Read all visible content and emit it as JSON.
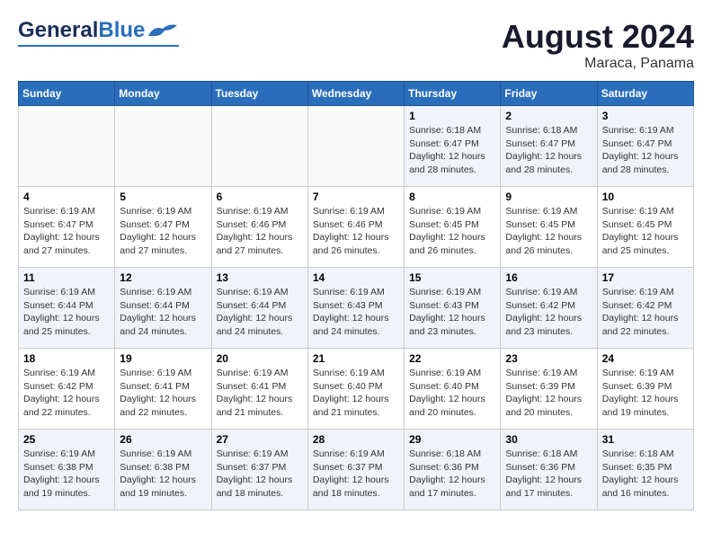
{
  "header": {
    "logo_general": "General",
    "logo_blue": "Blue",
    "title": "August 2024",
    "subtitle": "Maraca, Panama"
  },
  "days_of_week": [
    "Sunday",
    "Monday",
    "Tuesday",
    "Wednesday",
    "Thursday",
    "Friday",
    "Saturday"
  ],
  "weeks": [
    [
      {
        "day": "",
        "info": ""
      },
      {
        "day": "",
        "info": ""
      },
      {
        "day": "",
        "info": ""
      },
      {
        "day": "",
        "info": ""
      },
      {
        "day": "1",
        "info": "Sunrise: 6:18 AM\nSunset: 6:47 PM\nDaylight: 12 hours\nand 28 minutes."
      },
      {
        "day": "2",
        "info": "Sunrise: 6:18 AM\nSunset: 6:47 PM\nDaylight: 12 hours\nand 28 minutes."
      },
      {
        "day": "3",
        "info": "Sunrise: 6:19 AM\nSunset: 6:47 PM\nDaylight: 12 hours\nand 28 minutes."
      }
    ],
    [
      {
        "day": "4",
        "info": "Sunrise: 6:19 AM\nSunset: 6:47 PM\nDaylight: 12 hours\nand 27 minutes."
      },
      {
        "day": "5",
        "info": "Sunrise: 6:19 AM\nSunset: 6:47 PM\nDaylight: 12 hours\nand 27 minutes."
      },
      {
        "day": "6",
        "info": "Sunrise: 6:19 AM\nSunset: 6:46 PM\nDaylight: 12 hours\nand 27 minutes."
      },
      {
        "day": "7",
        "info": "Sunrise: 6:19 AM\nSunset: 6:46 PM\nDaylight: 12 hours\nand 26 minutes."
      },
      {
        "day": "8",
        "info": "Sunrise: 6:19 AM\nSunset: 6:45 PM\nDaylight: 12 hours\nand 26 minutes."
      },
      {
        "day": "9",
        "info": "Sunrise: 6:19 AM\nSunset: 6:45 PM\nDaylight: 12 hours\nand 26 minutes."
      },
      {
        "day": "10",
        "info": "Sunrise: 6:19 AM\nSunset: 6:45 PM\nDaylight: 12 hours\nand 25 minutes."
      }
    ],
    [
      {
        "day": "11",
        "info": "Sunrise: 6:19 AM\nSunset: 6:44 PM\nDaylight: 12 hours\nand 25 minutes."
      },
      {
        "day": "12",
        "info": "Sunrise: 6:19 AM\nSunset: 6:44 PM\nDaylight: 12 hours\nand 24 minutes."
      },
      {
        "day": "13",
        "info": "Sunrise: 6:19 AM\nSunset: 6:44 PM\nDaylight: 12 hours\nand 24 minutes."
      },
      {
        "day": "14",
        "info": "Sunrise: 6:19 AM\nSunset: 6:43 PM\nDaylight: 12 hours\nand 24 minutes."
      },
      {
        "day": "15",
        "info": "Sunrise: 6:19 AM\nSunset: 6:43 PM\nDaylight: 12 hours\nand 23 minutes."
      },
      {
        "day": "16",
        "info": "Sunrise: 6:19 AM\nSunset: 6:42 PM\nDaylight: 12 hours\nand 23 minutes."
      },
      {
        "day": "17",
        "info": "Sunrise: 6:19 AM\nSunset: 6:42 PM\nDaylight: 12 hours\nand 22 minutes."
      }
    ],
    [
      {
        "day": "18",
        "info": "Sunrise: 6:19 AM\nSunset: 6:42 PM\nDaylight: 12 hours\nand 22 minutes."
      },
      {
        "day": "19",
        "info": "Sunrise: 6:19 AM\nSunset: 6:41 PM\nDaylight: 12 hours\nand 22 minutes."
      },
      {
        "day": "20",
        "info": "Sunrise: 6:19 AM\nSunset: 6:41 PM\nDaylight: 12 hours\nand 21 minutes."
      },
      {
        "day": "21",
        "info": "Sunrise: 6:19 AM\nSunset: 6:40 PM\nDaylight: 12 hours\nand 21 minutes."
      },
      {
        "day": "22",
        "info": "Sunrise: 6:19 AM\nSunset: 6:40 PM\nDaylight: 12 hours\nand 20 minutes."
      },
      {
        "day": "23",
        "info": "Sunrise: 6:19 AM\nSunset: 6:39 PM\nDaylight: 12 hours\nand 20 minutes."
      },
      {
        "day": "24",
        "info": "Sunrise: 6:19 AM\nSunset: 6:39 PM\nDaylight: 12 hours\nand 19 minutes."
      }
    ],
    [
      {
        "day": "25",
        "info": "Sunrise: 6:19 AM\nSunset: 6:38 PM\nDaylight: 12 hours\nand 19 minutes."
      },
      {
        "day": "26",
        "info": "Sunrise: 6:19 AM\nSunset: 6:38 PM\nDaylight: 12 hours\nand 19 minutes."
      },
      {
        "day": "27",
        "info": "Sunrise: 6:19 AM\nSunset: 6:37 PM\nDaylight: 12 hours\nand 18 minutes."
      },
      {
        "day": "28",
        "info": "Sunrise: 6:19 AM\nSunset: 6:37 PM\nDaylight: 12 hours\nand 18 minutes."
      },
      {
        "day": "29",
        "info": "Sunrise: 6:18 AM\nSunset: 6:36 PM\nDaylight: 12 hours\nand 17 minutes."
      },
      {
        "day": "30",
        "info": "Sunrise: 6:18 AM\nSunset: 6:36 PM\nDaylight: 12 hours\nand 17 minutes."
      },
      {
        "day": "31",
        "info": "Sunrise: 6:18 AM\nSunset: 6:35 PM\nDaylight: 12 hours\nand 16 minutes."
      }
    ]
  ]
}
